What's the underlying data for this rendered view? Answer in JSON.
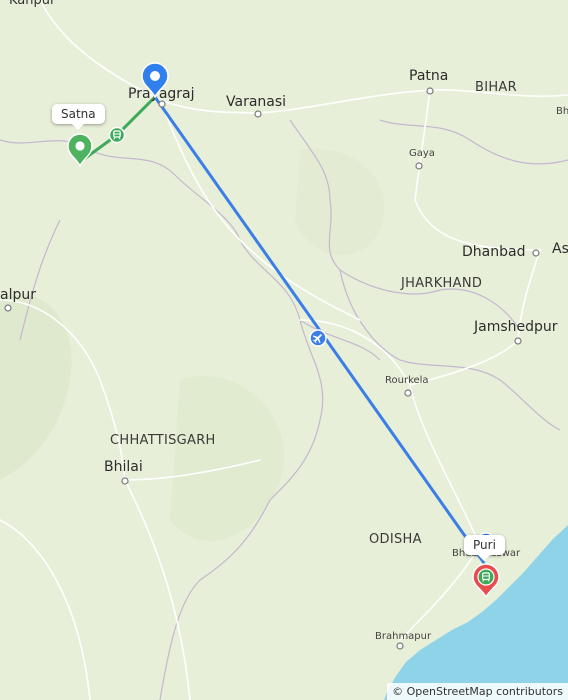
{
  "map": {
    "attribution": "© OpenStreetMap contributors",
    "colors": {
      "land": "#e7efd8",
      "sea": "#8fd3e8",
      "road": "#ffffff",
      "flight_route": "#3b7ee8",
      "ground_route": "#3daa5a",
      "pin_start": "#4db35e",
      "pin_hub": "#2f80ed",
      "pin_end": "#e94c4c"
    },
    "cities": [
      {
        "id": "kanpur",
        "name": "Kanpur"
      },
      {
        "id": "prayagraj",
        "name": "Prayagraj"
      },
      {
        "id": "varanasi",
        "name": "Varanasi"
      },
      {
        "id": "patna",
        "name": "Patna"
      },
      {
        "id": "gaya",
        "name": "Gaya"
      },
      {
        "id": "dhanbad",
        "name": "Dhanbad"
      },
      {
        "id": "asansol",
        "name": "As"
      },
      {
        "id": "jamshedpur",
        "name": "Jamshedpur"
      },
      {
        "id": "rourkela",
        "name": "Rourkela"
      },
      {
        "id": "bhilai",
        "name": "Bhilai"
      },
      {
        "id": "jabalpur",
        "name": "alpur"
      },
      {
        "id": "bhubaneswar",
        "name": "Bhubaneswar"
      },
      {
        "id": "brahmapur",
        "name": "Brahmapur"
      },
      {
        "id": "bh_edge",
        "name": "Bh"
      }
    ],
    "states": [
      {
        "id": "bihar",
        "name": "BIHAR"
      },
      {
        "id": "jharkhand",
        "name": "JHARKHAND"
      },
      {
        "id": "chhattisgarh",
        "name": "CHHATTISGARH"
      },
      {
        "id": "odisha",
        "name": "ODISHA"
      }
    ],
    "route": {
      "start": {
        "name": "Satna",
        "icon": "map-pin-icon"
      },
      "hub": {
        "name": "Prayagraj",
        "icon": "map-pin-icon"
      },
      "end": {
        "name": "Puri",
        "icon": "map-pin-icon"
      },
      "segments": [
        {
          "mode": "train",
          "icon": "train-icon",
          "from": "Satna",
          "to": "Prayagraj"
        },
        {
          "mode": "flight",
          "icon": "airplane-icon",
          "from": "Prayagraj",
          "to": "Bhubaneswar"
        },
        {
          "mode": "train",
          "icon": "train-icon",
          "from": "Bhubaneswar",
          "to": "Puri"
        }
      ]
    }
  }
}
